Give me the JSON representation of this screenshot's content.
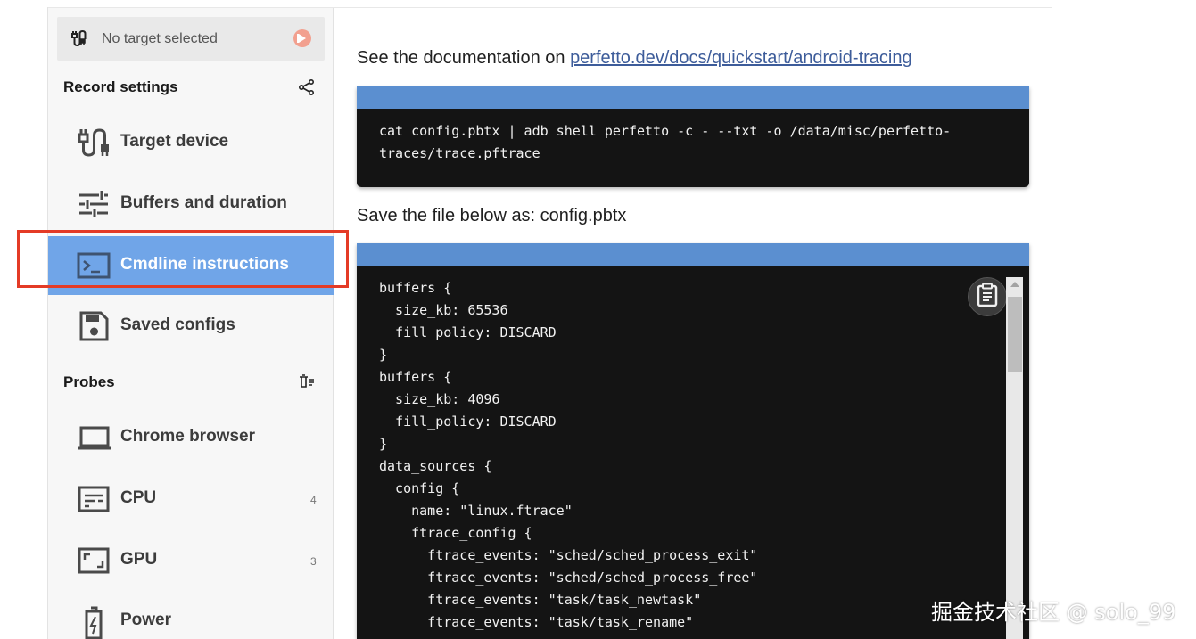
{
  "sidebar": {
    "target": {
      "text": "No target selected"
    },
    "record_settings_title": "Record settings",
    "items": [
      {
        "label": "Target device",
        "icon": "cable-icon"
      },
      {
        "label": "Buffers and duration",
        "icon": "tune-icon"
      },
      {
        "label": "Cmdline instructions",
        "icon": "terminal-icon",
        "active": true
      },
      {
        "label": "Saved configs",
        "icon": "save-icon"
      }
    ],
    "probes_title": "Probes",
    "probes": [
      {
        "label": "Chrome browser",
        "icon": "laptop-icon",
        "count": ""
      },
      {
        "label": "CPU",
        "icon": "cpu-icon",
        "count": "4"
      },
      {
        "label": "GPU",
        "icon": "gpu-icon",
        "count": "3"
      },
      {
        "label": "Power",
        "icon": "battery-icon",
        "count": ""
      }
    ]
  },
  "main": {
    "doc_prefix": "See the documentation on ",
    "doc_link": "perfetto.dev/docs/quickstart/android-tracing",
    "command": "cat config.pbtx | adb shell perfetto -c - --txt -o /data/misc/perfetto-\ntraces/trace.pftrace",
    "save_text": "Save the file below as: config.pbtx",
    "config": "buffers {\n  size_kb: 65536\n  fill_policy: DISCARD\n}\nbuffers {\n  size_kb: 4096\n  fill_policy: DISCARD\n}\ndata_sources {\n  config {\n    name: \"linux.ftrace\"\n    ftrace_config {\n      ftrace_events: \"sched/sched_process_exit\"\n      ftrace_events: \"sched/sched_process_free\"\n      ftrace_events: \"task/task_newtask\"\n      ftrace_events: \"task/task_rename\""
  },
  "watermark": "掘金技术社区 @ solo_99",
  "colors": {
    "active_bg": "#70a5e8",
    "code_bar": "#5b8fd0",
    "highlight": "#e43b26",
    "code_bg": "#141414"
  }
}
